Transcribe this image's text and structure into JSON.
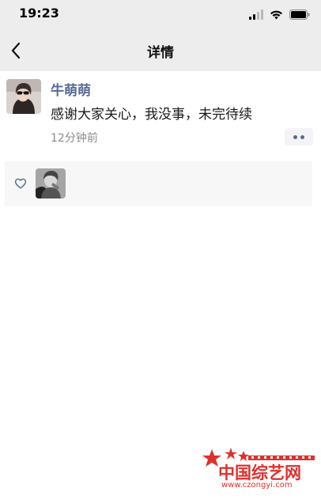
{
  "status_bar": {
    "time": "19:23",
    "icons": [
      "cellular-signal-icon",
      "wifi-icon",
      "battery-icon"
    ]
  },
  "nav": {
    "back_icon": "chevron-left-icon",
    "title": "详情"
  },
  "post": {
    "author": "牛萌萌",
    "content": "感谢大家关心，我没事，未完待续",
    "timestamp": "12分钟前",
    "more_icon": "more-dots-icon"
  },
  "likes": {
    "icon": "heart-outline-icon",
    "liker_count": 1
  },
  "watermark": {
    "title": "中国综艺网",
    "url": "www.czongyi.com"
  },
  "colors": {
    "bar_background": "#ededed",
    "author_name": "#576b95",
    "timestamp": "#8c8c8c",
    "likes_background": "#f7f7f7",
    "watermark_red": "#e0302c"
  }
}
